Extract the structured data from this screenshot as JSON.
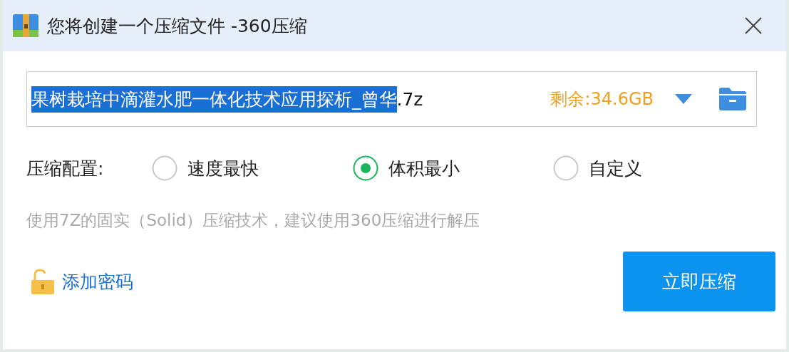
{
  "window": {
    "title": "您将创建一个压缩文件 -360压缩"
  },
  "filename": {
    "selected_text": "果树栽培中滴灌水肥一体化技术应用探析_曾华",
    "rest_text": ".7z",
    "free_space": "剩余:34.6GB"
  },
  "config": {
    "label": "压缩配置:",
    "options": [
      {
        "label": "速度最快",
        "selected": false
      },
      {
        "label": "体积最小",
        "selected": true
      },
      {
        "label": "自定义",
        "selected": false
      }
    ]
  },
  "hint": "使用7Z的固实（Solid）压缩技术，建议使用360压缩进行解压",
  "password_link": "添加密码",
  "compress_button": "立即压缩"
}
